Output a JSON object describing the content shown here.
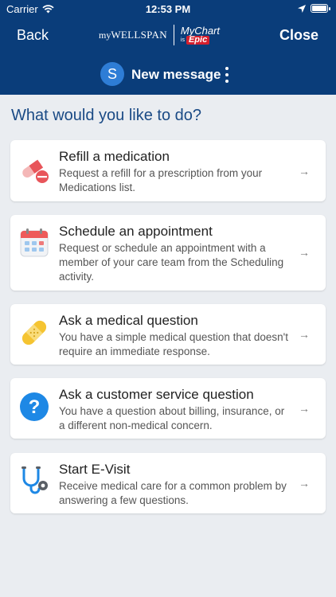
{
  "status_bar": {
    "carrier": "Carrier",
    "time": "12:53 PM"
  },
  "nav": {
    "back_label": "Back",
    "close_label": "Close"
  },
  "brand": {
    "my": "my",
    "wellspan": "WELLSPAN",
    "mychart": "MyChart",
    "is": "is",
    "epic": "Epic"
  },
  "conversation": {
    "avatar_initial": "S",
    "title": "New message"
  },
  "prompt": "What would you like to do?",
  "options": [
    {
      "title": "Refill a medication",
      "description": "Request a refill for a prescription from your Medications list.",
      "icon": "pill-icon"
    },
    {
      "title": "Schedule an appointment",
      "description": "Request or schedule an appointment with a member of your care team from the Scheduling activity.",
      "icon": "calendar-icon"
    },
    {
      "title": "Ask a medical question",
      "description": "You have a simple medical question that doesn't require an immediate response.",
      "icon": "bandage-icon"
    },
    {
      "title": "Ask a customer service question",
      "description": "You have a question about billing, insurance, or a different non-medical concern.",
      "icon": "question-icon"
    },
    {
      "title": "Start E-Visit",
      "description": "Receive medical care for a common problem by answering a few questions.",
      "icon": "stethoscope-icon"
    }
  ],
  "colors": {
    "header": "#0a3d7a",
    "accent": "#2e7dd6",
    "prompt": "#1a4a85",
    "background": "#eaedf1"
  }
}
